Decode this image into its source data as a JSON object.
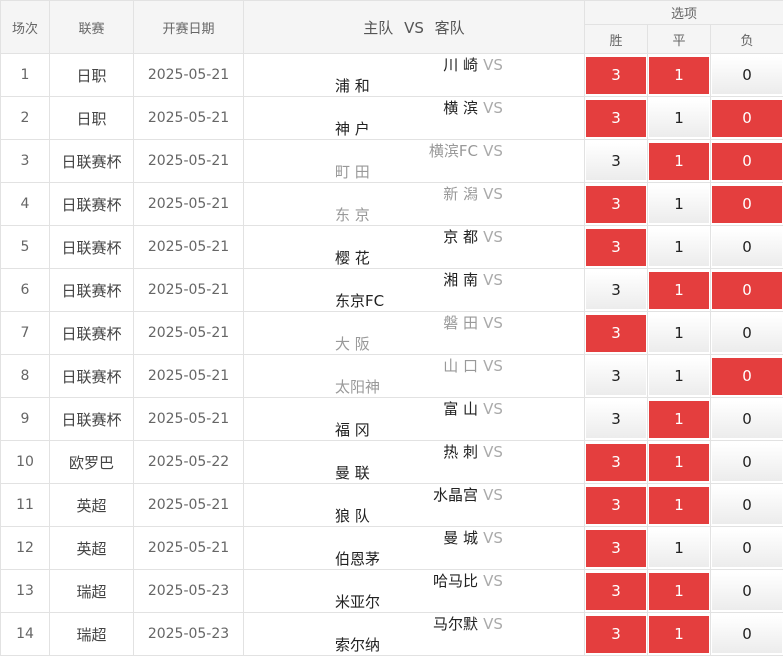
{
  "header": {
    "col_index": "场次",
    "col_league": "联赛",
    "col_date": "开赛日期",
    "col_home": "主队",
    "col_vs": "VS",
    "col_away": "客队",
    "col_options": "选项",
    "opt_win": "胜",
    "opt_draw": "平",
    "opt_lose": "负"
  },
  "colors": {
    "selected": "#e43e3e",
    "dim_team": "#999999",
    "team": "#222222"
  },
  "rows": [
    {
      "idx": "1",
      "league": "日职",
      "date": "2025-05-21",
      "home": "川 崎",
      "vs": "VS",
      "away": "浦 和",
      "dim_home": false,
      "dim_away": false,
      "win": "3",
      "draw": "1",
      "lose": "0",
      "sel": [
        true,
        true,
        false
      ]
    },
    {
      "idx": "2",
      "league": "日职",
      "date": "2025-05-21",
      "home": "横 滨",
      "vs": "VS",
      "away": "神 户",
      "dim_home": false,
      "dim_away": false,
      "win": "3",
      "draw": "1",
      "lose": "0",
      "sel": [
        true,
        false,
        true
      ]
    },
    {
      "idx": "3",
      "league": "日联赛杯",
      "date": "2025-05-21",
      "home": "横滨FC",
      "vs": "VS",
      "away": "町 田",
      "dim_home": true,
      "dim_away": true,
      "win": "3",
      "draw": "1",
      "lose": "0",
      "sel": [
        false,
        true,
        true
      ]
    },
    {
      "idx": "4",
      "league": "日联赛杯",
      "date": "2025-05-21",
      "home": "新 潟",
      "vs": "VS",
      "away": "东 京",
      "dim_home": true,
      "dim_away": true,
      "win": "3",
      "draw": "1",
      "lose": "0",
      "sel": [
        true,
        false,
        true
      ]
    },
    {
      "idx": "5",
      "league": "日联赛杯",
      "date": "2025-05-21",
      "home": "京 都",
      "vs": "VS",
      "away": "樱 花",
      "dim_home": false,
      "dim_away": false,
      "win": "3",
      "draw": "1",
      "lose": "0",
      "sel": [
        true,
        false,
        false
      ]
    },
    {
      "idx": "6",
      "league": "日联赛杯",
      "date": "2025-05-21",
      "home": "湘 南",
      "vs": "VS",
      "away": "东京FC",
      "dim_home": false,
      "dim_away": false,
      "win": "3",
      "draw": "1",
      "lose": "0",
      "sel": [
        false,
        true,
        true
      ]
    },
    {
      "idx": "7",
      "league": "日联赛杯",
      "date": "2025-05-21",
      "home": "磐 田",
      "vs": "VS",
      "away": "大 阪",
      "dim_home": true,
      "dim_away": true,
      "win": "3",
      "draw": "1",
      "lose": "0",
      "sel": [
        true,
        false,
        false
      ]
    },
    {
      "idx": "8",
      "league": "日联赛杯",
      "date": "2025-05-21",
      "home": "山 口",
      "vs": "VS",
      "away": "太阳神",
      "dim_home": true,
      "dim_away": true,
      "win": "3",
      "draw": "1",
      "lose": "0",
      "sel": [
        false,
        false,
        true
      ]
    },
    {
      "idx": "9",
      "league": "日联赛杯",
      "date": "2025-05-21",
      "home": "富 山",
      "vs": "VS",
      "away": "福 冈",
      "dim_home": false,
      "dim_away": false,
      "win": "3",
      "draw": "1",
      "lose": "0",
      "sel": [
        false,
        true,
        false
      ]
    },
    {
      "idx": "10",
      "league": "欧罗巴",
      "date": "2025-05-22",
      "home": "热 刺",
      "vs": "VS",
      "away": "曼 联",
      "dim_home": false,
      "dim_away": false,
      "win": "3",
      "draw": "1",
      "lose": "0",
      "sel": [
        true,
        true,
        false
      ]
    },
    {
      "idx": "11",
      "league": "英超",
      "date": "2025-05-21",
      "home": "水晶宫",
      "vs": "VS",
      "away": "狼 队",
      "dim_home": false,
      "dim_away": false,
      "win": "3",
      "draw": "1",
      "lose": "0",
      "sel": [
        true,
        true,
        false
      ]
    },
    {
      "idx": "12",
      "league": "英超",
      "date": "2025-05-21",
      "home": "曼 城",
      "vs": "VS",
      "away": "伯恩茅",
      "dim_home": false,
      "dim_away": false,
      "win": "3",
      "draw": "1",
      "lose": "0",
      "sel": [
        true,
        false,
        false
      ]
    },
    {
      "idx": "13",
      "league": "瑞超",
      "date": "2025-05-23",
      "home": "哈马比",
      "vs": "VS",
      "away": "米亚尔",
      "dim_home": false,
      "dim_away": false,
      "win": "3",
      "draw": "1",
      "lose": "0",
      "sel": [
        true,
        true,
        false
      ]
    },
    {
      "idx": "14",
      "league": "瑞超",
      "date": "2025-05-23",
      "home": "马尔默",
      "vs": "VS",
      "away": "索尔纳",
      "dim_home": false,
      "dim_away": false,
      "win": "3",
      "draw": "1",
      "lose": "0",
      "sel": [
        true,
        true,
        false
      ]
    }
  ]
}
